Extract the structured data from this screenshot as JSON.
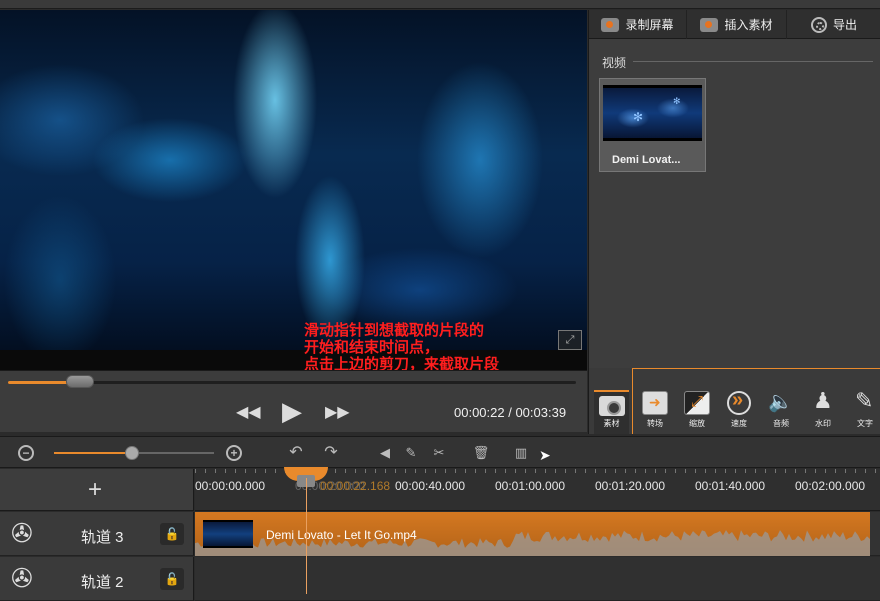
{
  "preview": {
    "annotation": "滑动指针到想截取的片段的\n开始和结束时间点，\n点击上边的剪刀，来截取片段",
    "fullscreen_icon": "fullscreen-icon"
  },
  "player": {
    "progress_fraction": 0.117,
    "current_time": "00:00:22",
    "duration": "00:03:39",
    "time_readout": "00:00:22 / 00:03:39"
  },
  "right_panel": {
    "tabs": [
      {
        "label": "录制屏幕",
        "icon": "record-screen-icon"
      },
      {
        "label": "插入素材",
        "icon": "camera-icon"
      },
      {
        "label": "导出",
        "icon": "film-reel-icon"
      }
    ],
    "section_label": "视频",
    "media": [
      {
        "name": "Demi Lovat..."
      }
    ],
    "tools": {
      "material_label": "素材",
      "items": [
        {
          "label": "转场",
          "icon": "transition-icon"
        },
        {
          "label": "缩放",
          "icon": "zoom-icon"
        },
        {
          "label": "速度",
          "icon": "speed-icon"
        },
        {
          "label": "音频",
          "icon": "audio-icon"
        },
        {
          "label": "水印",
          "icon": "watermark-icon"
        },
        {
          "label": "文字",
          "icon": "text-icon"
        }
      ]
    }
  },
  "timeline": {
    "zoom_fraction": 0.49,
    "ruler_ticks": [
      "00:00:00.000",
      "00:00:20.000",
      "00:00:40.000",
      "00:01:00.000",
      "00:01:20.000",
      "00:01:40.000",
      "00:02:00.000"
    ],
    "playhead_time": "00:00:22.168",
    "tracks": [
      {
        "name": "轨道 3",
        "clip_name": "Demi Lovato - Let It Go.mp4"
      },
      {
        "name": "轨道 2"
      }
    ],
    "add_track_label": "+"
  },
  "colors": {
    "accent": "#e98a2c",
    "annotation": "#ff1e1e"
  }
}
